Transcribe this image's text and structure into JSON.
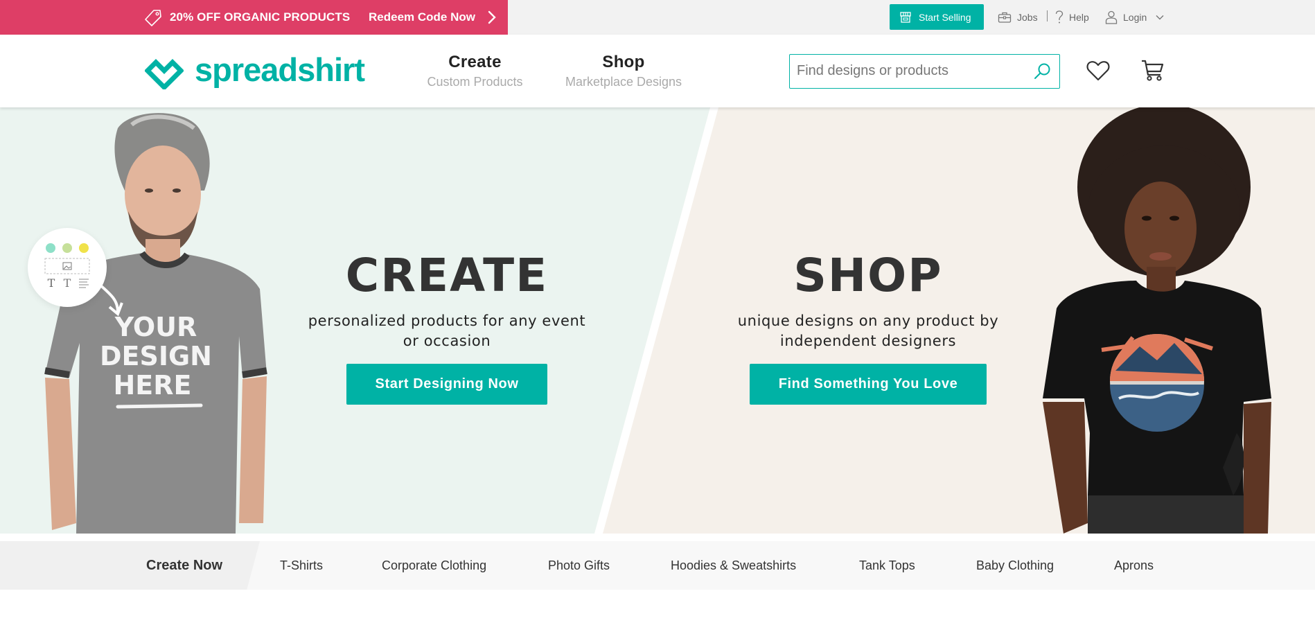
{
  "colors": {
    "brand": "#00b2a5",
    "promo": "#de3e66",
    "hero_left_bg": "#ebf4f0",
    "hero_right_bg": "#f5f0ea"
  },
  "promo_bar": {
    "icon": "tag-icon",
    "text": "20% OFF ORGANIC PRODUCTS",
    "link_label": "Redeem Code Now",
    "link_icon": "chevron-right-icon"
  },
  "utility_nav": {
    "start_selling": {
      "label": "Start Selling",
      "icon": "shop-icon"
    },
    "jobs": {
      "label": "Jobs",
      "icon": "briefcase-icon"
    },
    "help": {
      "label": "Help",
      "icon": "question-icon"
    },
    "login": {
      "label": "Login",
      "icon": "user-icon",
      "dropdown_icon": "chevron-down-icon"
    }
  },
  "header": {
    "logo_text": "spreadshirt",
    "nav": [
      {
        "title": "Create",
        "subtitle": "Custom Products"
      },
      {
        "title": "Shop",
        "subtitle": "Marketplace Designs"
      }
    ],
    "search": {
      "placeholder": "Find designs or products",
      "value": "",
      "icon": "search-icon"
    },
    "wishlist_icon": "heart-icon",
    "cart_icon": "cart-icon"
  },
  "hero": {
    "create": {
      "title": "CREATE",
      "description": "personalized products for any event or occasion",
      "button": "Start Designing Now",
      "image_text": [
        "YOUR",
        "DESIGN",
        "HERE"
      ],
      "bubble_colors": [
        "#8ee0c8",
        "#c6e09a",
        "#f0e24a"
      ]
    },
    "shop": {
      "title": "SHOP",
      "description": "unique designs on any product by independent designers",
      "button": "Find Something You Love"
    }
  },
  "category_bar": {
    "primary": "Create Now",
    "items": [
      "T-Shirts",
      "Corporate Clothing",
      "Photo Gifts",
      "Hoodies & Sweatshirts",
      "Tank Tops",
      "Baby Clothing",
      "Aprons"
    ]
  }
}
